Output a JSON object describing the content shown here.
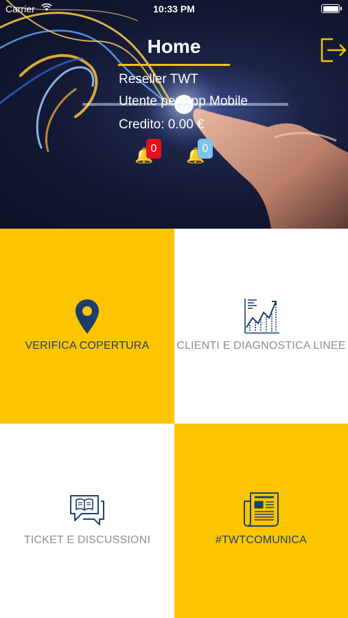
{
  "status_bar": {
    "carrier": "Carrier",
    "time": "10:33 PM"
  },
  "header": {
    "title": "Home",
    "reseller": "Reseller TWT",
    "user": "Utente per App Mobile",
    "credit": "Credito: 0.00 €",
    "notifications": [
      {
        "icon": "bell-icon",
        "count": "0",
        "color": "#e8101c"
      },
      {
        "icon": "bell-icon",
        "count": "0",
        "color": "#7fc2ec"
      }
    ],
    "logout_icon": "logout-icon"
  },
  "tiles": [
    {
      "label": "VERIFICA COPERTURA",
      "icon": "map-pin-icon",
      "background": "#fcc500"
    },
    {
      "label": "CLIENTI E DIAGNOSTICA LINEE",
      "icon": "chart-icon",
      "background": "#ffffff"
    },
    {
      "label": "TICKET E DISCUSSIONI",
      "icon": "chat-book-icon",
      "background": "#ffffff"
    },
    {
      "label": "#TWTCOMUNICA",
      "icon": "newspaper-icon",
      "background": "#fcc500"
    }
  ],
  "colors": {
    "accent": "#fcc500",
    "icon_blue": "#1e3e6e"
  }
}
